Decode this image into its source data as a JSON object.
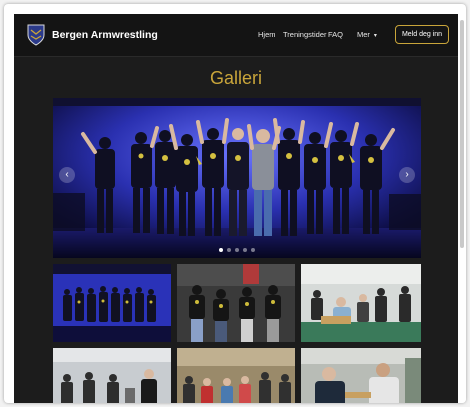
{
  "navbar": {
    "brand": "Bergen Armwrestling",
    "links": [
      "Hjem",
      "Treningstider",
      "FAQ",
      "Mer"
    ],
    "cta": "Meld deg inn"
  },
  "page": {
    "title": "Galleri"
  },
  "carousel": {
    "slide_count": 5,
    "active_slide": 1
  },
  "icons": {
    "logo": "club-crest-logo",
    "dropdown": "chevron-down-icon",
    "prev": "chevron-left-icon",
    "next": "chevron-right-icon"
  },
  "colors": {
    "accent": "#c9a53a",
    "nav_background": "#141414",
    "page_background": "#1c1c1c",
    "stage_light": "#3344cc"
  }
}
